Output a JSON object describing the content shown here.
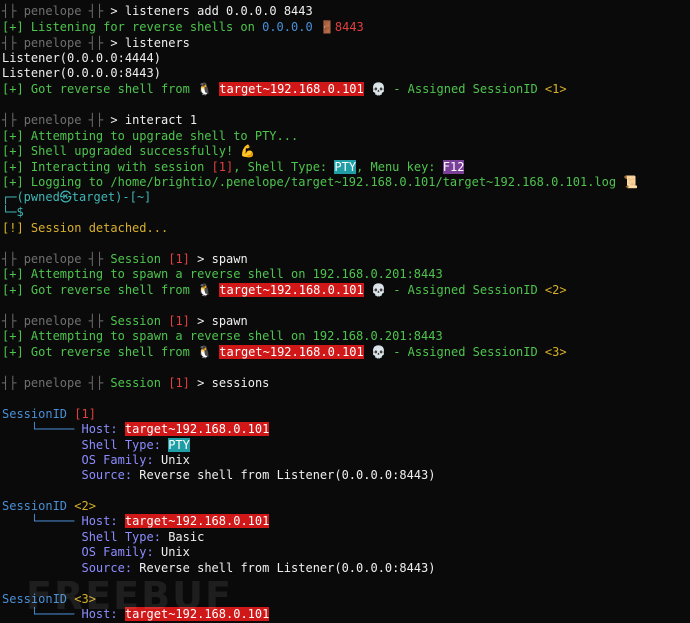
{
  "prompt": {
    "app": "penelope",
    "sep": "┤├",
    "session": "Session",
    "sid1": "[1]",
    "arrow": ">"
  },
  "commands": {
    "listeners_add": "listeners add 0.0.0.0 8443",
    "listeners": "listeners",
    "interact": "interact 1",
    "spawn": "spawn",
    "sessions": "sessions"
  },
  "lines": {
    "listening": "[+] Listening for reverse shells on",
    "listen_ip": "0.0.0.0",
    "listen_port": "8443",
    "listener1": "Listener(0.0.0.0:4444)",
    "listener2": "Listener(0.0.0.0:8443)",
    "got_shell": "[+] Got reverse shell from",
    "target": "target~192.168.0.101",
    "assigned": "- Assigned SessionID",
    "sid_1": "<1>",
    "sid_2": "<2>",
    "sid_3": "<3>",
    "attempt_pty": "[+] Attempting to upgrade shell to PTY...",
    "upgraded": "[+] Shell upgraded successfully!",
    "interacting": "[+] Interacting with session",
    "interacting_sid": "[1]",
    "shell_type_lbl": ", Shell Type:",
    "pty": "PTY",
    "menu_key_lbl": ", Menu key:",
    "f12": "F12",
    "logging": "[+] Logging to /home/brightio/.penelope/target~192.168.0.101/target~192.168.0.101.log",
    "pwned_prompt": "┌─(pwned㉿target)-[~]",
    "dollar_prompt": "└─$",
    "detached": "[!] Session detached...",
    "spawn_attempt": "[+] Attempting to spawn a reverse shell on 192.168.0.201:8443"
  },
  "sessions": {
    "sid_label": "SessionID",
    "host_label": "Host:",
    "shell_type_label": "Shell Type:",
    "os_label": "OS Family:",
    "source_label": "Source:",
    "os_value": "Unix",
    "source_value": "Reverse shell from Listener(0.0.0.0:8443)",
    "s1_id": "[1]",
    "s1_shell": "PTY",
    "s2_id": "<2>",
    "s2_shell": "Basic",
    "s3_id": "<3>"
  },
  "watermark": "FREEBUF",
  "icons": {
    "penguin": "🐧",
    "skull": "💀",
    "muscle": "💪",
    "scroll": "📜",
    "door": "🚪"
  }
}
